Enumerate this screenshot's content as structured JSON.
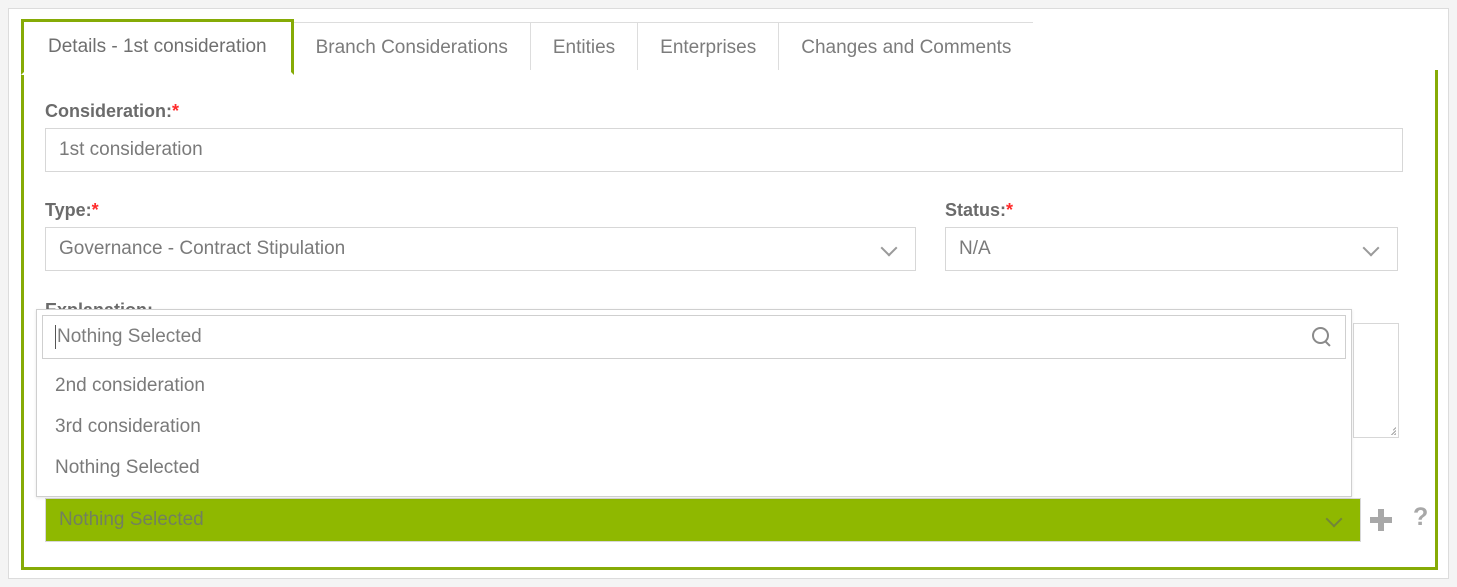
{
  "tabs": [
    {
      "label": "Details - 1st consideration",
      "active": true
    },
    {
      "label": "Branch Considerations",
      "active": false
    },
    {
      "label": "Entities",
      "active": false
    },
    {
      "label": "Enterprises",
      "active": false
    },
    {
      "label": "Changes and Comments",
      "active": false
    }
  ],
  "form": {
    "consideration": {
      "label": "Consideration:",
      "required_marker": "*",
      "value": "1st consideration"
    },
    "type": {
      "label": "Type:",
      "required_marker": "*",
      "value": "Governance - Contract Stipulation"
    },
    "status": {
      "label": "Status:",
      "required_marker": "*",
      "value": "N/A"
    },
    "explanation": {
      "label": "Explanation:",
      "value": ""
    },
    "linked_select": {
      "value": "Nothing Selected"
    }
  },
  "dropdown": {
    "open": true,
    "search_value": "Nothing Selected",
    "search_placeholder": "Nothing Selected",
    "search_icon": "search-icon",
    "options": [
      "2nd consideration",
      "3rd consideration",
      "Nothing Selected"
    ]
  },
  "actions": {
    "add_label": "+",
    "help_label": "?"
  },
  "colors": {
    "accent_green": "#8fb800",
    "border_green": "#86ab06",
    "required_red": "#ff2a2a",
    "text_gray": "#7a7a7a",
    "label_gray": "#6b6b6b",
    "border_gray": "#d7d7d7"
  }
}
